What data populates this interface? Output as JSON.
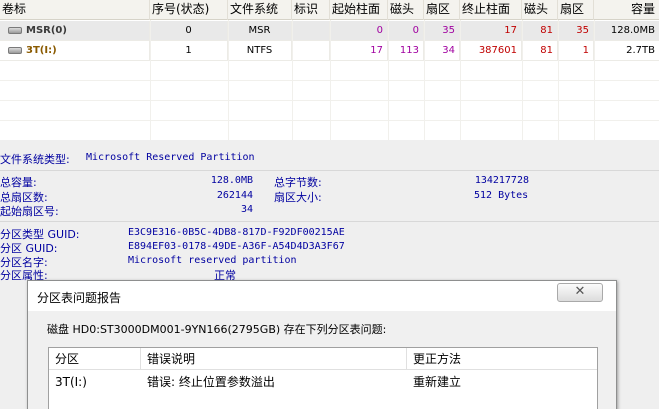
{
  "partition_table": {
    "columns": [
      "卷标",
      "序号(状态)",
      "文件系统",
      "标识",
      "起始柱面",
      "磁头",
      "扇区",
      "终止柱面",
      "磁头",
      "扇区",
      "容量"
    ],
    "rows": [
      {
        "label": "MSR(0)",
        "index": "0",
        "fs": "MSR",
        "id": "",
        "start_cyl": "0",
        "start_head": "0",
        "start_sec": "35",
        "end_cyl": "17",
        "end_head": "81",
        "end_sec": "35",
        "capacity": "128.0MB"
      },
      {
        "label": "3T(I:)",
        "index": "1",
        "fs": "NTFS",
        "id": "",
        "start_cyl": "17",
        "start_head": "113",
        "start_sec": "34",
        "end_cyl": "387601",
        "end_head": "81",
        "end_sec": "1",
        "capacity": "2.7TB"
      }
    ]
  },
  "info": {
    "fs_type_label": "文件系统类型:",
    "fs_type_value": "Microsoft Reserved Partition",
    "total_capacity_label": "总容量:",
    "total_capacity_value": "128.0MB",
    "total_sectors_label": "总扇区数:",
    "total_sectors_value": "262144",
    "start_sector_label": "起始扇区号:",
    "start_sector_value": "34",
    "total_bytes_label": "总字节数:",
    "total_bytes_value": "134217728",
    "sector_size_label": "扇区大小:",
    "sector_size_value": "512 Bytes",
    "type_guid_label": "分区类型 GUID:",
    "type_guid_value": "E3C9E316-0B5C-4DB8-817D-F92DF00215AE",
    "guid_label": "分区 GUID:",
    "guid_value": "E894EF03-0178-49DE-A36F-A54D4D3A3F67",
    "name_label": "分区名字:",
    "name_value": "Microsoft reserved partition",
    "attr_label": "分区属性:",
    "attr_value": "正常"
  },
  "dialog": {
    "title": "分区表问题报告",
    "close_glyph": "✕",
    "message": "磁盘 HD0:ST3000DM001-9YN166(2795GB) 存在下列分区表问题:",
    "columns": [
      "分区",
      "错误说明",
      "更正方法"
    ],
    "rows": [
      {
        "partition": "3T(I:)",
        "error": "错误: 终止位置参数溢出",
        "fix": "重新建立"
      }
    ]
  },
  "colors": {
    "number_purple": "#a000a0",
    "number_red": "#c00000",
    "info_blue": "#0000a0",
    "label_orange": "#8a5a00"
  }
}
